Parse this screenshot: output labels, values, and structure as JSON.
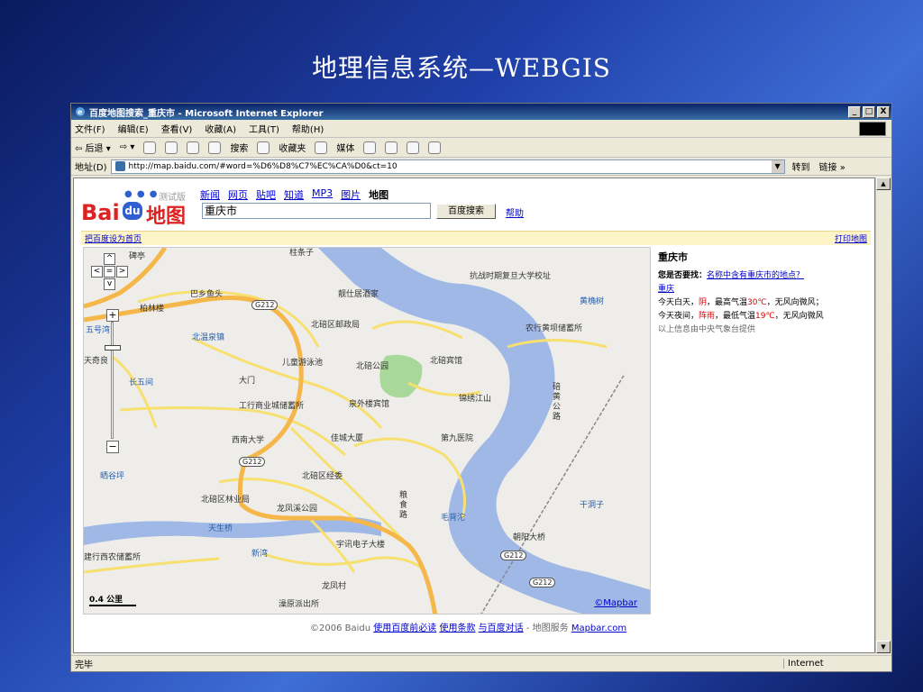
{
  "slide": {
    "title": "地理信息系统—WEBGIS"
  },
  "window": {
    "title": "百度地图搜索_重庆市 - Microsoft Internet Explorer",
    "controls": {
      "minimize": "_",
      "maximize": "□",
      "close": "X"
    }
  },
  "menubar": [
    "文件(F)",
    "编辑(E)",
    "查看(V)",
    "收藏(A)",
    "工具(T)",
    "帮助(H)"
  ],
  "toolbar": {
    "back": "⇦ 后退 ▾",
    "forward": "⇨ ▾",
    "search": "搜索",
    "favorites": "收藏夹",
    "media": "媒体"
  },
  "address": {
    "label": "地址(D)",
    "url": "http://map.baidu.com/#word=%D6%D8%C7%EC%CA%D0&ct=10",
    "go": "转到",
    "links": "链接 »"
  },
  "baidu": {
    "logo_bai": "Bai",
    "logo_du": "du",
    "logo_ditu": "地图",
    "beta": "测试版",
    "nav": [
      "新闻",
      "网页",
      "贴吧",
      "知道",
      "MP3",
      "图片",
      "地图"
    ],
    "query": "重庆市",
    "search_button": "百度搜索",
    "help": "帮助",
    "set_home": "把百度设为首页",
    "print_map": "打印地图"
  },
  "map": {
    "labels": [
      "巴乡鱼头",
      "柏林楼",
      "北温泉镇",
      "北碚区邮政局",
      "靓仕居酒家",
      "抗战时期复旦大学校址",
      "北碚宾馆",
      "北碚公园",
      "儿童游泳池",
      "大门",
      "泉外楼宾馆",
      "工行商业城储蓄所",
      "锦绣江山",
      "西南大学",
      "佳城大厦",
      "第九医院",
      "北碚区经委",
      "北碚区林业局",
      "龙凤溪公园",
      "天生桥",
      "宇讯电子大楼",
      "新湾",
      "朝阳大桥",
      "龙凤村",
      "澡原派出所",
      "建行西农储蓄所",
      "晒谷坪",
      "长五间",
      "五号湾",
      "天奇良",
      "毛背沱",
      "干洞子",
      "黄桷树",
      "农行黄坝储蓄所",
      "碑亭",
      "柱条子",
      "粮食路",
      "碚黄公路"
    ],
    "road_shields": [
      "G212",
      "G212",
      "G212",
      "G212"
    ],
    "scale": "0.4 公里",
    "credit": "©Mapbar"
  },
  "side": {
    "city": "重庆市",
    "prompt": "您是否要找：",
    "suggestion": "名称中含有重庆市的地点？",
    "link2": "重庆",
    "weather_day_a": "今天白天，",
    "weather_day_b": "阴",
    "weather_day_c": "，最高气温",
    "weather_day_d": "30℃",
    "weather_day_e": "，无风向微风；",
    "weather_night_a": "今天夜间，",
    "weather_night_b": "阵雨",
    "weather_night_c": "，最低气温",
    "weather_night_d": "19℃",
    "weather_night_e": "，无风向微风",
    "weather_source": "以上信息由中央气象台提供"
  },
  "footer": {
    "copyright": "©2006 Baidu",
    "l1": "使用百度前必读",
    "l2": "使用条款",
    "l3": "与百度对话",
    "mid": "- 地图服务",
    "l4": "Mapbar.com"
  },
  "status": {
    "text": "完毕",
    "zone": "Internet"
  },
  "colors": {
    "titlebar": "#0a246a",
    "map_river": "#9fb8e6",
    "road_major": "#f5b74a",
    "road_minor": "#f7e070"
  }
}
